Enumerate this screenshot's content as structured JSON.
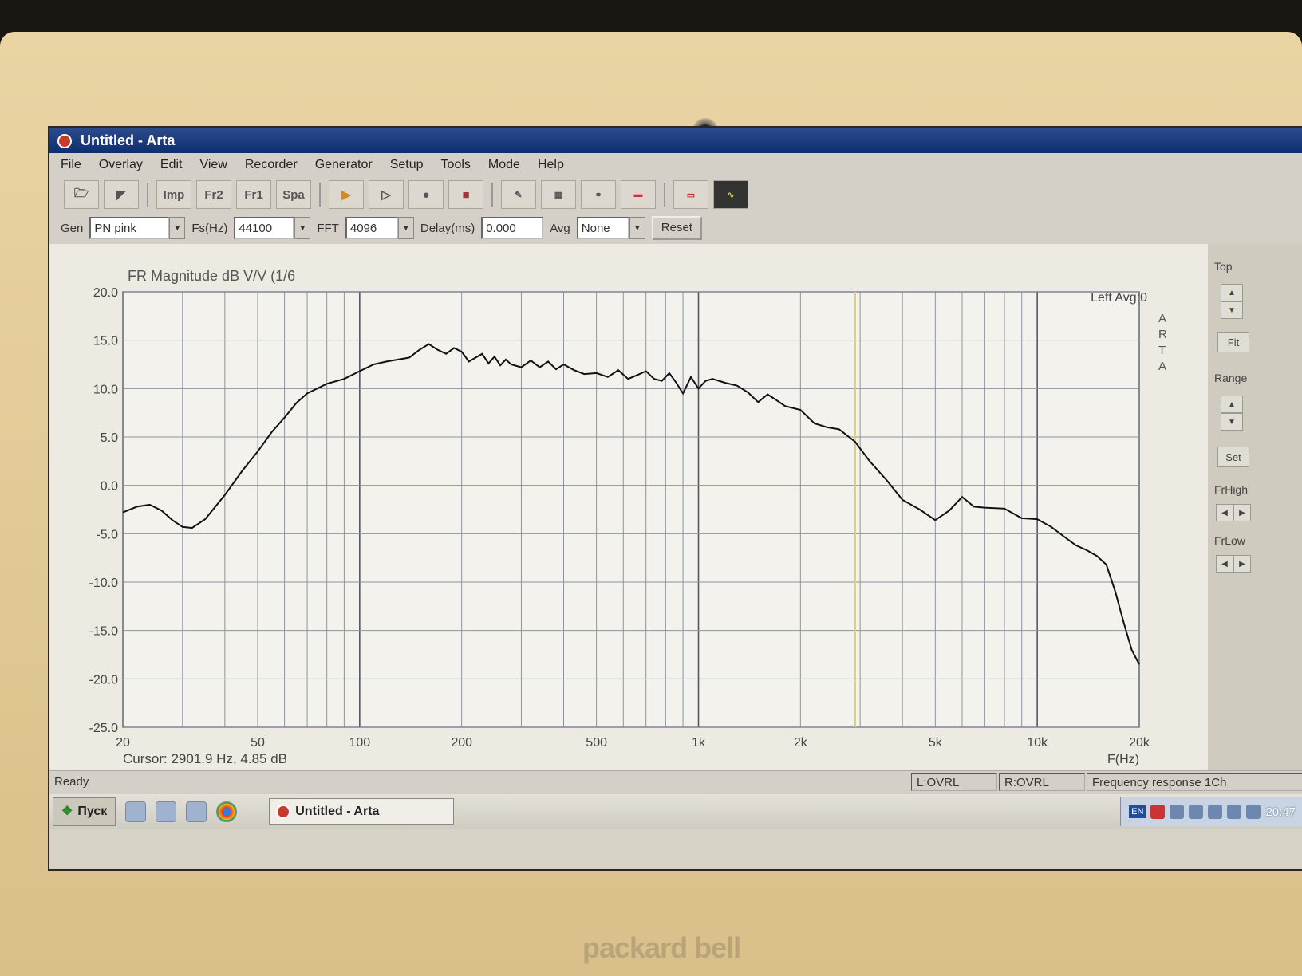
{
  "window": {
    "title": "Untitled - Arta"
  },
  "menu": [
    "File",
    "Overlay",
    "Edit",
    "View",
    "Recorder",
    "Generator",
    "Setup",
    "Tools",
    "Mode",
    "Help"
  ],
  "toolbar": {
    "buttons": [
      "Imp",
      "Fr2",
      "Fr1",
      "Spa"
    ]
  },
  "controls": {
    "gen_label": "Gen",
    "gen_value": "PN pink",
    "fs_label": "Fs(Hz)",
    "fs_value": "44100",
    "fft_label": "FFT",
    "fft_value": "4096",
    "delay_label": "Delay(ms)",
    "delay_value": "0.000",
    "avg_label": "Avg",
    "avg_value": "None",
    "reset_label": "Reset"
  },
  "plot": {
    "title": "FR Magnitude dB V/V (1/6",
    "legend": "Left Avg:0",
    "arta": [
      "A",
      "R",
      "T",
      "A"
    ],
    "cursor_text": "Cursor:  2901.9 Hz, 4.85 dB",
    "xlabel": "F(Hz)"
  },
  "right_panel": {
    "top_label": "Top",
    "fit_label": "Fit",
    "range_label": "Range",
    "set_label": "Set",
    "frhigh_label": "FrHigh",
    "frlow_label": "FrLow"
  },
  "status": {
    "ready": "Ready",
    "l_ovrl": "L:OVRL",
    "r_ovrl": "R:OVRL",
    "mode": "Frequency response 1Ch"
  },
  "taskbar": {
    "start": "Пуск",
    "task": "Untitled - Arta",
    "lang": "EN",
    "clock": "20:47"
  },
  "laptop": {
    "brand": "packard bell"
  },
  "chart_data": {
    "type": "line",
    "title": "FR Magnitude dB V/V (1/6",
    "xlabel": "F(Hz)",
    "ylabel": "",
    "xscale": "log",
    "xlim": [
      20,
      20000
    ],
    "ylim": [
      -25,
      20
    ],
    "x_ticks": [
      20,
      50,
      100,
      200,
      500,
      1000,
      2000,
      5000,
      10000,
      20000
    ],
    "x_tick_labels": [
      "20",
      "50",
      "100",
      "200",
      "500",
      "1k",
      "2k",
      "5k",
      "10k",
      "20k"
    ],
    "y_ticks": [
      20,
      15,
      10,
      5,
      0,
      -5,
      -10,
      -15,
      -20,
      -25
    ],
    "y_tick_labels": [
      "20.0",
      "15.0",
      "10.0",
      "5.0",
      "0.0",
      "-5.0",
      "-10.0",
      "-15.0",
      "-20.0",
      "-25.0"
    ],
    "cursor": {
      "x": 2901.9,
      "y": 4.85
    },
    "grid": true,
    "legend_position": "top-right",
    "series": [
      {
        "name": "Left Avg:0",
        "x": [
          20,
          22,
          24,
          26,
          28,
          30,
          32,
          35,
          40,
          45,
          50,
          55,
          60,
          65,
          70,
          80,
          90,
          100,
          110,
          120,
          130,
          140,
          150,
          160,
          170,
          180,
          190,
          200,
          210,
          220,
          230,
          240,
          250,
          260,
          270,
          280,
          300,
          320,
          340,
          360,
          380,
          400,
          430,
          460,
          500,
          540,
          580,
          620,
          660,
          700,
          740,
          780,
          820,
          860,
          900,
          950,
          1000,
          1050,
          1100,
          1200,
          1300,
          1400,
          1500,
          1600,
          1700,
          1800,
          2000,
          2200,
          2400,
          2600,
          2900,
          3200,
          3600,
          4000,
          4500,
          5000,
          5500,
          6000,
          6500,
          7000,
          8000,
          9000,
          10000,
          11000,
          12000,
          13000,
          14000,
          15000,
          16000,
          17000,
          18000,
          19000,
          20000
        ],
        "y": [
          -2.8,
          -2.2,
          -2.0,
          -2.6,
          -3.6,
          -4.3,
          -4.4,
          -3.5,
          -1.0,
          1.5,
          3.5,
          5.5,
          7.0,
          8.5,
          9.5,
          10.5,
          11.0,
          11.8,
          12.5,
          12.8,
          13.0,
          13.2,
          14.0,
          14.6,
          14.0,
          13.6,
          14.2,
          13.8,
          12.8,
          13.2,
          13.6,
          12.6,
          13.3,
          12.4,
          13.0,
          12.5,
          12.2,
          12.9,
          12.2,
          12.8,
          12.0,
          12.5,
          11.9,
          11.5,
          11.6,
          11.2,
          11.9,
          11.0,
          11.4,
          11.8,
          11.0,
          10.8,
          11.6,
          10.6,
          9.5,
          11.2,
          10.0,
          10.8,
          11.0,
          10.6,
          10.3,
          9.6,
          8.6,
          9.4,
          8.8,
          8.2,
          7.8,
          6.4,
          6.0,
          5.8,
          4.5,
          2.5,
          0.5,
          -1.5,
          -2.5,
          -3.6,
          -2.6,
          -1.2,
          -2.2,
          -2.3,
          -2.4,
          -3.4,
          -3.5,
          -4.3,
          -5.3,
          -6.2,
          -6.7,
          -7.3,
          -8.2,
          -11.0,
          -14.2,
          -17.0,
          -18.5
        ]
      }
    ]
  }
}
